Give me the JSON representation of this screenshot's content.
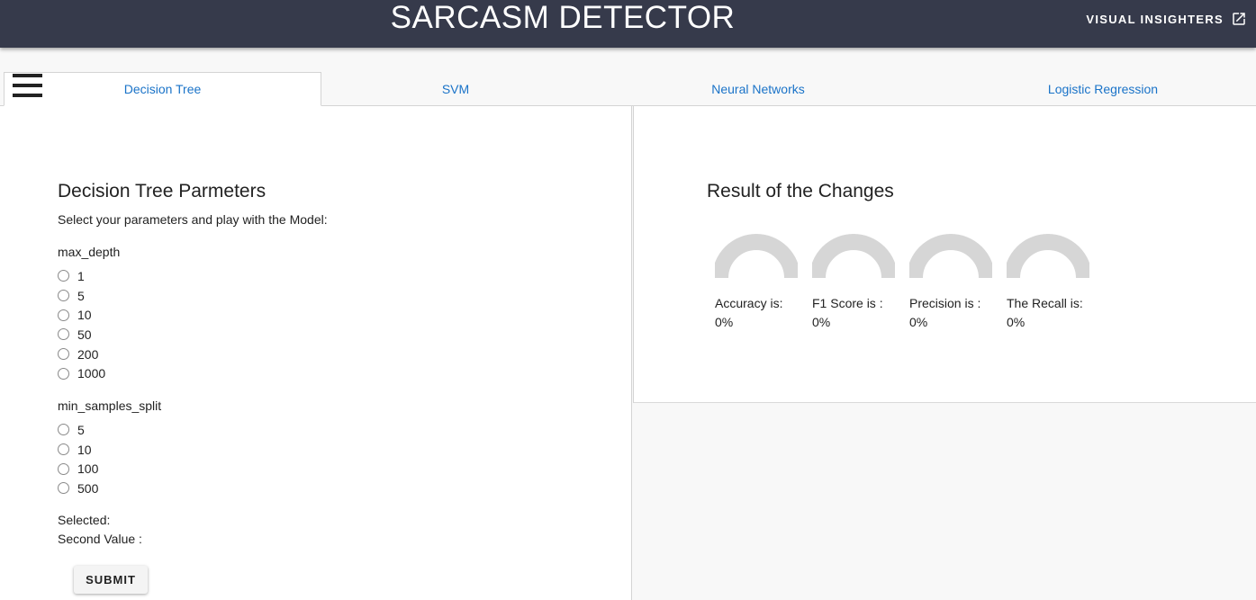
{
  "header": {
    "title": "SARCASM DETECTOR",
    "link_label": "VISUAL INSIGHTERS"
  },
  "tabs": [
    {
      "label": "Decision Tree",
      "active": true
    },
    {
      "label": "SVM",
      "active": false
    },
    {
      "label": "Neural Networks",
      "active": false
    },
    {
      "label": "Logistic Regression",
      "active": false
    }
  ],
  "params": {
    "title": "Decision Tree Parmeters",
    "subtitle": "Select your parameters and play with the Model:",
    "max_depth": {
      "label": "max_depth",
      "options": [
        "1",
        "5",
        "10",
        "50",
        "200",
        "1000"
      ]
    },
    "min_samples_split": {
      "label": "min_samples_split",
      "options": [
        "5",
        "10",
        "100",
        "500"
      ]
    },
    "selected_label": "Selected:",
    "second_value_label": "Second Value :",
    "submit_label": "SUBMIT"
  },
  "results": {
    "title": "Result of the Changes",
    "gauges": [
      {
        "label": "Accuracy is:",
        "value": "0%"
      },
      {
        "label": "F1 Score is :",
        "value": "0%"
      },
      {
        "label": "Precision is :",
        "value": "0%"
      },
      {
        "label": "The Recall is:",
        "value": "0%"
      }
    ]
  },
  "colors": {
    "appbar": "#363a4b",
    "tab_text": "#1a73c8",
    "gauge_track": "#d6d6d6"
  }
}
